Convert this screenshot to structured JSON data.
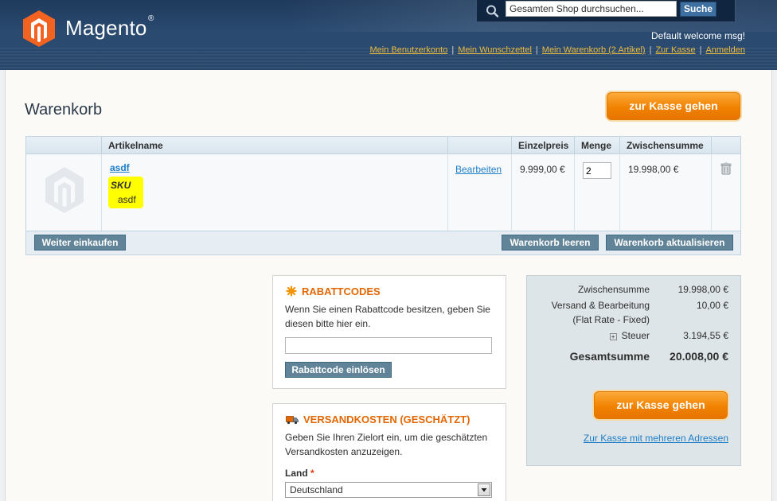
{
  "header": {
    "logo_text": "Magento",
    "logo_reg": "®",
    "search_placeholder": "Gesamten Shop durchsuchen...",
    "search_value": "Gesamten Shop durchsuchen...",
    "search_button": "Suche",
    "welcome": "Default welcome msg!",
    "links": [
      "Mein Benutzerkonto",
      "Mein Wunschzettel",
      "Mein Warenkorb (2 Artikel)",
      "Zur Kasse",
      "Anmelden"
    ]
  },
  "page": {
    "title": "Warenkorb",
    "checkout_button": "zur Kasse gehen"
  },
  "cart_table": {
    "columns": [
      "Artikelname",
      "Einzelpreis",
      "Menge",
      "Zwischensumme"
    ],
    "rows": [
      {
        "name": "asdf",
        "sku_label": "SKU",
        "sku_value": "asdf",
        "edit": "Bearbeiten",
        "unit_price": "9.999,00 €",
        "qty": "2",
        "subtotal": "19.998,00 €"
      }
    ],
    "continue_button": "Weiter einkaufen",
    "clear_button": "Warenkorb leeren",
    "update_button": "Warenkorb aktualisieren"
  },
  "coupon": {
    "title": "RABATTCODES",
    "text": "Wenn Sie einen Rabattcode besitzen, geben Sie diesen bitte hier ein.",
    "input_value": "",
    "button": "Rabattcode einlösen"
  },
  "shipping": {
    "title": "VERSANDKOSTEN (GESCHÄTZT)",
    "text": "Geben Sie Ihren Zielort ein, um die geschätzten Versandkosten anzuzeigen.",
    "country_label": "Land",
    "required_mark": "*",
    "country_value": "Deutschland"
  },
  "totals": {
    "subtotal_label": "Zwischensumme",
    "subtotal_value": "19.998,00 €",
    "shipping_label": "Versand & Bearbeitung",
    "shipping_sub": "(Flat Rate - Fixed)",
    "shipping_value": "10,00 €",
    "tax_label": "Steuer",
    "tax_value": "3.194,55 €",
    "grand_label": "Gesamtsumme",
    "grand_value": "20.008,00 €",
    "checkout_button": "zur Kasse gehen",
    "multi_address_link": "Zur Kasse mit mehreren Adressen"
  },
  "colors": {
    "accent_orange": "#f18200",
    "link_blue": "#1e7ec8",
    "header_blue": "#2a4a70",
    "button_gray_blue": "#618499",
    "highlight_yellow": "#ffff00"
  }
}
